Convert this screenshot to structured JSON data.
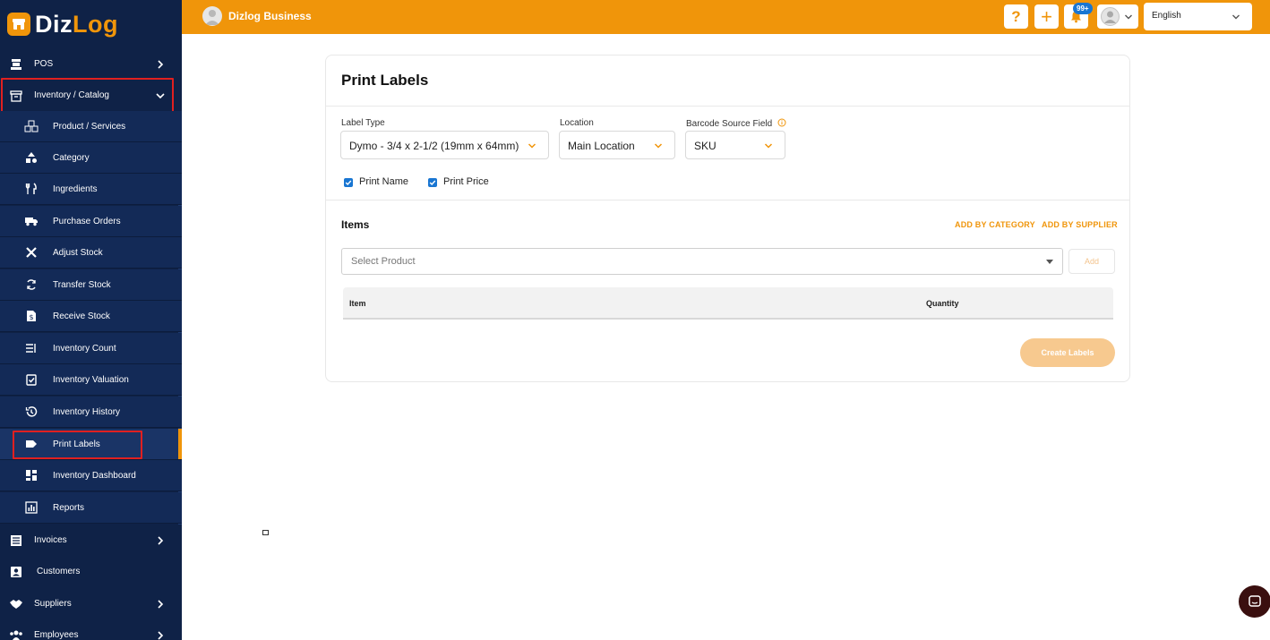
{
  "brand": {
    "part1": "Diz",
    "part2": "Log"
  },
  "sidebar": {
    "top_items": [
      {
        "label": "POS"
      },
      {
        "label": "Inventory / Catalog"
      }
    ],
    "sub_items": [
      {
        "label": "Product / Services"
      },
      {
        "label": "Category"
      },
      {
        "label": "Ingredients"
      },
      {
        "label": "Purchase Orders"
      },
      {
        "label": "Adjust Stock"
      },
      {
        "label": "Transfer Stock"
      },
      {
        "label": "Receive Stock"
      },
      {
        "label": "Inventory Count"
      },
      {
        "label": "Inventory Valuation"
      },
      {
        "label": "Inventory History"
      },
      {
        "label": "Print Labels"
      },
      {
        "label": "Inventory Dashboard"
      },
      {
        "label": "Reports"
      }
    ],
    "bottom_items": [
      {
        "label": "Invoices"
      },
      {
        "label": "Customers"
      },
      {
        "label": "Suppliers"
      },
      {
        "label": "Employees"
      }
    ],
    "active_item": "Print Labels"
  },
  "header": {
    "business_name": "Dizlog Business",
    "help_icon": "?",
    "add_icon": "+",
    "notification_badge": "99+",
    "language": "English"
  },
  "page": {
    "title": "Print Labels",
    "label_type": {
      "label": "Label Type",
      "value": "Dymo - 3/4 x 2-1/2 (19mm x 64mm)"
    },
    "location": {
      "label": "Location",
      "value": "Main Location"
    },
    "barcode_source": {
      "label": "Barcode Source Field",
      "value": "SKU"
    },
    "print_name": {
      "label": "Print Name",
      "checked": true
    },
    "print_price": {
      "label": "Print Price",
      "checked": true
    },
    "items_title": "Items",
    "add_by_category": "ADD BY CATEGORY",
    "add_by_supplier": "ADD BY SUPPLIER",
    "product_placeholder": "Select Product",
    "add_button": "Add",
    "table_headers": {
      "item": "Item",
      "quantity": "Quantity"
    },
    "create_button": "Create Labels"
  },
  "colors": {
    "accent": "#f0950a",
    "sidebar": "#0f2247",
    "checkbox": "#1976d2",
    "highlight": "#e02020"
  }
}
